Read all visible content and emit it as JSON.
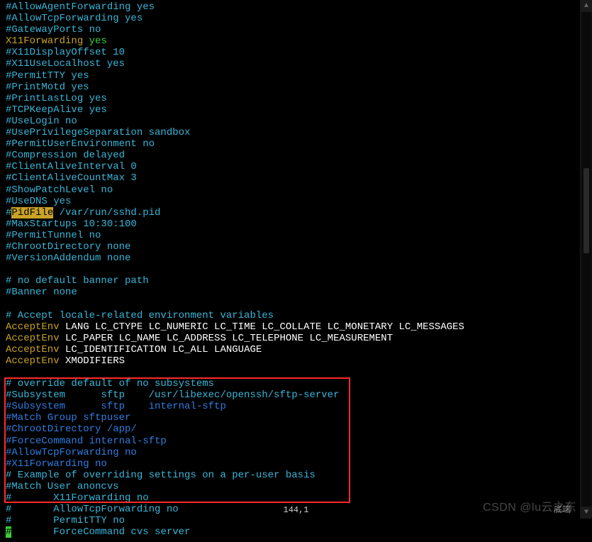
{
  "lines": [
    [
      {
        "cls": "c-cyan",
        "t": "#AllowAgentForwarding yes"
      }
    ],
    [
      {
        "cls": "c-cyan",
        "t": "#AllowTcpForwarding yes"
      }
    ],
    [
      {
        "cls": "c-cyan",
        "t": "#GatewayPorts no"
      }
    ],
    [
      {
        "cls": "c-yellow",
        "t": "X11Forwarding "
      },
      {
        "cls": "c-lime",
        "t": "yes"
      }
    ],
    [
      {
        "cls": "c-cyan",
        "t": "#X11DisplayOffset 10"
      }
    ],
    [
      {
        "cls": "c-cyan",
        "t": "#X11UseLocalhost yes"
      }
    ],
    [
      {
        "cls": "c-cyan",
        "t": "#PermitTTY yes"
      }
    ],
    [
      {
        "cls": "c-cyan",
        "t": "#PrintMotd yes"
      }
    ],
    [
      {
        "cls": "c-cyan",
        "t": "#PrintLastLog yes"
      }
    ],
    [
      {
        "cls": "c-cyan",
        "t": "#TCPKeepAlive yes"
      }
    ],
    [
      {
        "cls": "c-cyan",
        "t": "#UseLogin no"
      }
    ],
    [
      {
        "cls": "c-cyan",
        "t": "#UsePrivilegeSeparation sandbox"
      }
    ],
    [
      {
        "cls": "c-cyan",
        "t": "#PermitUserEnvironment no"
      }
    ],
    [
      {
        "cls": "c-cyan",
        "t": "#Compression delayed"
      }
    ],
    [
      {
        "cls": "c-cyan",
        "t": "#ClientAliveInterval 0"
      }
    ],
    [
      {
        "cls": "c-cyan",
        "t": "#ClientAliveCountMax 3"
      }
    ],
    [
      {
        "cls": "c-cyan",
        "t": "#ShowPatchLevel no"
      }
    ],
    [
      {
        "cls": "c-cyan",
        "t": "#UseDNS yes"
      }
    ],
    [
      {
        "cls": "c-cyan",
        "t": "#"
      },
      {
        "cls": "hl-search",
        "t": "PidFile"
      },
      {
        "cls": "c-cyan",
        "t": " /var/run/sshd.pid"
      }
    ],
    [
      {
        "cls": "c-cyan",
        "t": "#MaxStartups 10:30:100"
      }
    ],
    [
      {
        "cls": "c-cyan",
        "t": "#PermitTunnel no"
      }
    ],
    [
      {
        "cls": "c-cyan",
        "t": "#ChrootDirectory none"
      }
    ],
    [
      {
        "cls": "c-cyan",
        "t": "#VersionAddendum none"
      }
    ],
    [],
    [
      {
        "cls": "c-cyan",
        "t": "# no default banner path"
      }
    ],
    [
      {
        "cls": "c-cyan",
        "t": "#Banner none"
      }
    ],
    [],
    [
      {
        "cls": "c-cyan",
        "t": "# Accept locale-related environment variables"
      }
    ],
    [
      {
        "cls": "c-yellow",
        "t": "AcceptEnv"
      },
      {
        "cls": "c-white",
        "t": " LANG LC_CTYPE LC_NUMERIC LC_TIME LC_COLLATE LC_MONETARY LC_MESSAGES"
      }
    ],
    [
      {
        "cls": "c-yellow",
        "t": "AcceptEnv"
      },
      {
        "cls": "c-white",
        "t": " LC_PAPER LC_NAME LC_ADDRESS LC_TELEPHONE LC_MEASUREMENT"
      }
    ],
    [
      {
        "cls": "c-yellow",
        "t": "AcceptEnv"
      },
      {
        "cls": "c-white",
        "t": " LC_IDENTIFICATION LC_ALL LANGUAGE"
      }
    ],
    [
      {
        "cls": "c-yellow",
        "t": "AcceptEnv"
      },
      {
        "cls": "c-white",
        "t": " XMODIFIERS"
      }
    ],
    [],
    [
      {
        "cls": "c-cyan",
        "t": "# override default of no subsystems"
      }
    ],
    [
      {
        "cls": "c-cyan",
        "t": "#Subsystem      sftp    /usr/libexec/openssh/sftp-server"
      }
    ],
    [
      {
        "cls": "c-blue",
        "t": "#Subsystem      sftp    internal-sftp"
      }
    ],
    [
      {
        "cls": "c-blue",
        "t": "#Match Group sftpuser"
      }
    ],
    [
      {
        "cls": "c-blue",
        "t": "#ChrootDirectory /app/"
      }
    ],
    [
      {
        "cls": "c-blue",
        "t": "#ForceCommand internal-sftp"
      }
    ],
    [
      {
        "cls": "c-blue",
        "t": "#AllowTcpForwarding no"
      }
    ],
    [
      {
        "cls": "c-blue",
        "t": "#X11Forwarding no"
      }
    ],
    [
      {
        "cls": "c-cyan",
        "t": "# Example of overriding settings on a per-user basis"
      }
    ],
    [
      {
        "cls": "c-cyan",
        "t": "#Match User anoncvs"
      }
    ],
    [
      {
        "cls": "c-cyan",
        "t": "#       X11Forwarding no"
      }
    ],
    [
      {
        "cls": "c-cyan",
        "t": "#       AllowTcpForwarding no"
      }
    ],
    [
      {
        "cls": "c-cyan",
        "t": "#       PermitTTY no"
      }
    ],
    [
      {
        "cls": "green-cursor",
        "t": "#"
      },
      {
        "cls": "c-cyan",
        "t": "       ForceCommand cvs server"
      }
    ]
  ],
  "status": {
    "cursor": "144,1",
    "right_label": "底端"
  },
  "watermark": "CSDN @lu云之东",
  "scrollbar": {
    "up": "▲",
    "down": "▼"
  }
}
